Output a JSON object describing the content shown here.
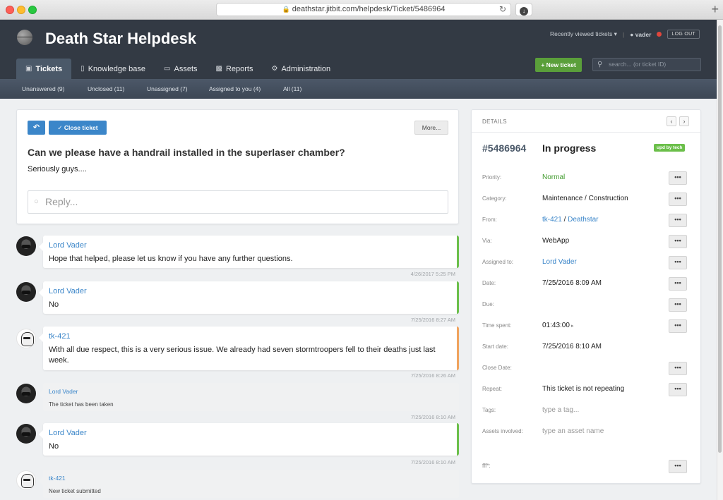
{
  "browser": {
    "url": "deathstar.jitbit.com/helpdesk/Ticket/5486964"
  },
  "header": {
    "title": "Death Star Helpdesk",
    "recently_viewed": "Recently viewed tickets ▾",
    "user": "vader",
    "logout": "LOG OUT",
    "new_ticket": "+ New ticket",
    "search_placeholder": "search... (or ticket ID)",
    "tabs": [
      {
        "label": "Tickets",
        "icon": "inbox-icon"
      },
      {
        "label": "Knowledge base",
        "icon": "book-icon"
      },
      {
        "label": "Assets",
        "icon": "laptop-icon"
      },
      {
        "label": "Reports",
        "icon": "bar-chart-icon"
      },
      {
        "label": "Administration",
        "icon": "gear-icon"
      }
    ]
  },
  "subnav": [
    "Unanswered (9)",
    "Unclosed (11)",
    "Unassigned (7)",
    "Assigned to you (4)",
    "All (11)"
  ],
  "ticket": {
    "close_label": "Close ticket",
    "more_label": "More...",
    "subject": "Can we please have a handrail installed in the superlaser chamber?",
    "body": "Seriously guys....",
    "reply_placeholder": "Reply..."
  },
  "comments": [
    {
      "author": "Lord Vader",
      "text": "Hope that helped, please let us know if you have any further questions.",
      "time": "4/26/2017 5:25 PM"
    },
    {
      "author": "Lord Vader",
      "text": "No",
      "time": "7/25/2016 8:27 AM"
    },
    {
      "author": "tk-421",
      "text": "With all due respect, this is a very serious issue. We already had seven stormtroopers fell to their deaths just last week.",
      "time": "7/25/2016 8:26 AM"
    },
    {
      "author": "Lord Vader",
      "text": "The ticket has been taken",
      "time": "7/25/2016 8:10 AM"
    },
    {
      "author": "Lord Vader",
      "text": "No",
      "time": "7/25/2016 8:10 AM"
    },
    {
      "author": "tk-421",
      "text": "New ticket submitted",
      "time": ""
    }
  ],
  "details": {
    "heading": "DETAILS",
    "ticket_id": "#5486964",
    "status": "In progress",
    "badge": "upd by tech",
    "more_button": "•••",
    "rows": {
      "priority": {
        "label": "Priority:",
        "value": "Normal"
      },
      "category": {
        "label": "Category:",
        "value": "Maintenance / Construction"
      },
      "from": {
        "label": "From:",
        "user": "tk-421",
        "sep": " / ",
        "company": "Deathstar"
      },
      "via": {
        "label": "Via:",
        "value": "WebApp"
      },
      "assigned": {
        "label": "Assigned to:",
        "value": "Lord Vader"
      },
      "date": {
        "label": "Date:",
        "value": "7/25/2016 8:09 AM"
      },
      "due": {
        "label": "Due:",
        "value": ""
      },
      "time_spent": {
        "label": "Time spent:",
        "value": "01:43:00",
        "timer": "▸"
      },
      "start_date": {
        "label": "Start date:",
        "value": "7/25/2016 8:10 AM"
      },
      "close_date": {
        "label": "Close Date:",
        "value": ""
      },
      "repeat": {
        "label": "Repeat:",
        "value": "This ticket is not repeating"
      },
      "tags": {
        "label": "Tags:",
        "value": "type a tag..."
      },
      "assets": {
        "label": "Assets involved:",
        "value": "type an asset name"
      },
      "custom": {
        "label": "fff*:",
        "value": ""
      }
    }
  }
}
